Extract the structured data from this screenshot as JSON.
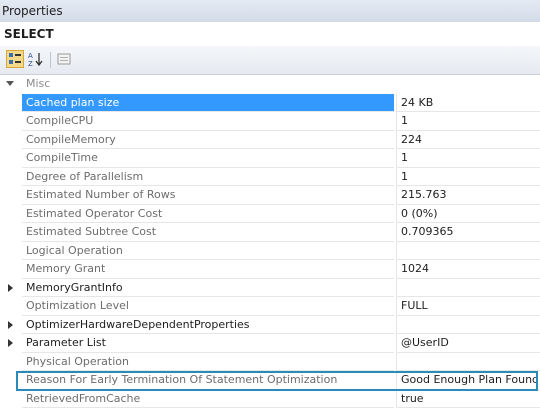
{
  "window": {
    "title": "Properties"
  },
  "object": {
    "name": "SELECT"
  },
  "toolbar": {
    "buttons": [
      {
        "icon": "categorized-icon",
        "active": true
      },
      {
        "icon": "alphabetical-sort-icon",
        "active": false
      },
      {
        "icon": "property-pages-icon",
        "active": false
      }
    ]
  },
  "grid": {
    "category": "Misc",
    "rows": [
      {
        "name": "Cached plan size",
        "value": "24 KB",
        "state": "selected"
      },
      {
        "name": "CompileCPU",
        "value": "1",
        "state": "dim"
      },
      {
        "name": "CompileMemory",
        "value": "224",
        "state": "dim"
      },
      {
        "name": "CompileTime",
        "value": "1",
        "state": "dim"
      },
      {
        "name": "Degree of Parallelism",
        "value": "1",
        "state": "dim"
      },
      {
        "name": "Estimated Number of Rows",
        "value": "215.763",
        "state": "dim"
      },
      {
        "name": "Estimated Operator Cost",
        "value": "0 (0%)",
        "state": "dim"
      },
      {
        "name": "Estimated Subtree Cost",
        "value": "0.709365",
        "state": "dim"
      },
      {
        "name": "Logical Operation",
        "value": "",
        "state": "dim"
      },
      {
        "name": "Memory Grant",
        "value": "1024",
        "state": "dim"
      },
      {
        "name": "MemoryGrantInfo",
        "value": "",
        "state": "expandable"
      },
      {
        "name": "Optimization Level",
        "value": "FULL",
        "state": "dim"
      },
      {
        "name": "OptimizerHardwareDependentProperties",
        "value": "",
        "state": "expandable"
      },
      {
        "name": "Parameter List",
        "value": "@UserID",
        "state": "expandable"
      },
      {
        "name": "Physical Operation",
        "value": "",
        "state": "dim"
      },
      {
        "name": "Reason For Early Termination Of Statement Optimization",
        "value": "Good Enough Plan Found",
        "state": "dim"
      },
      {
        "name": "RetrievedFromCache",
        "value": "true",
        "state": "dim"
      }
    ]
  }
}
